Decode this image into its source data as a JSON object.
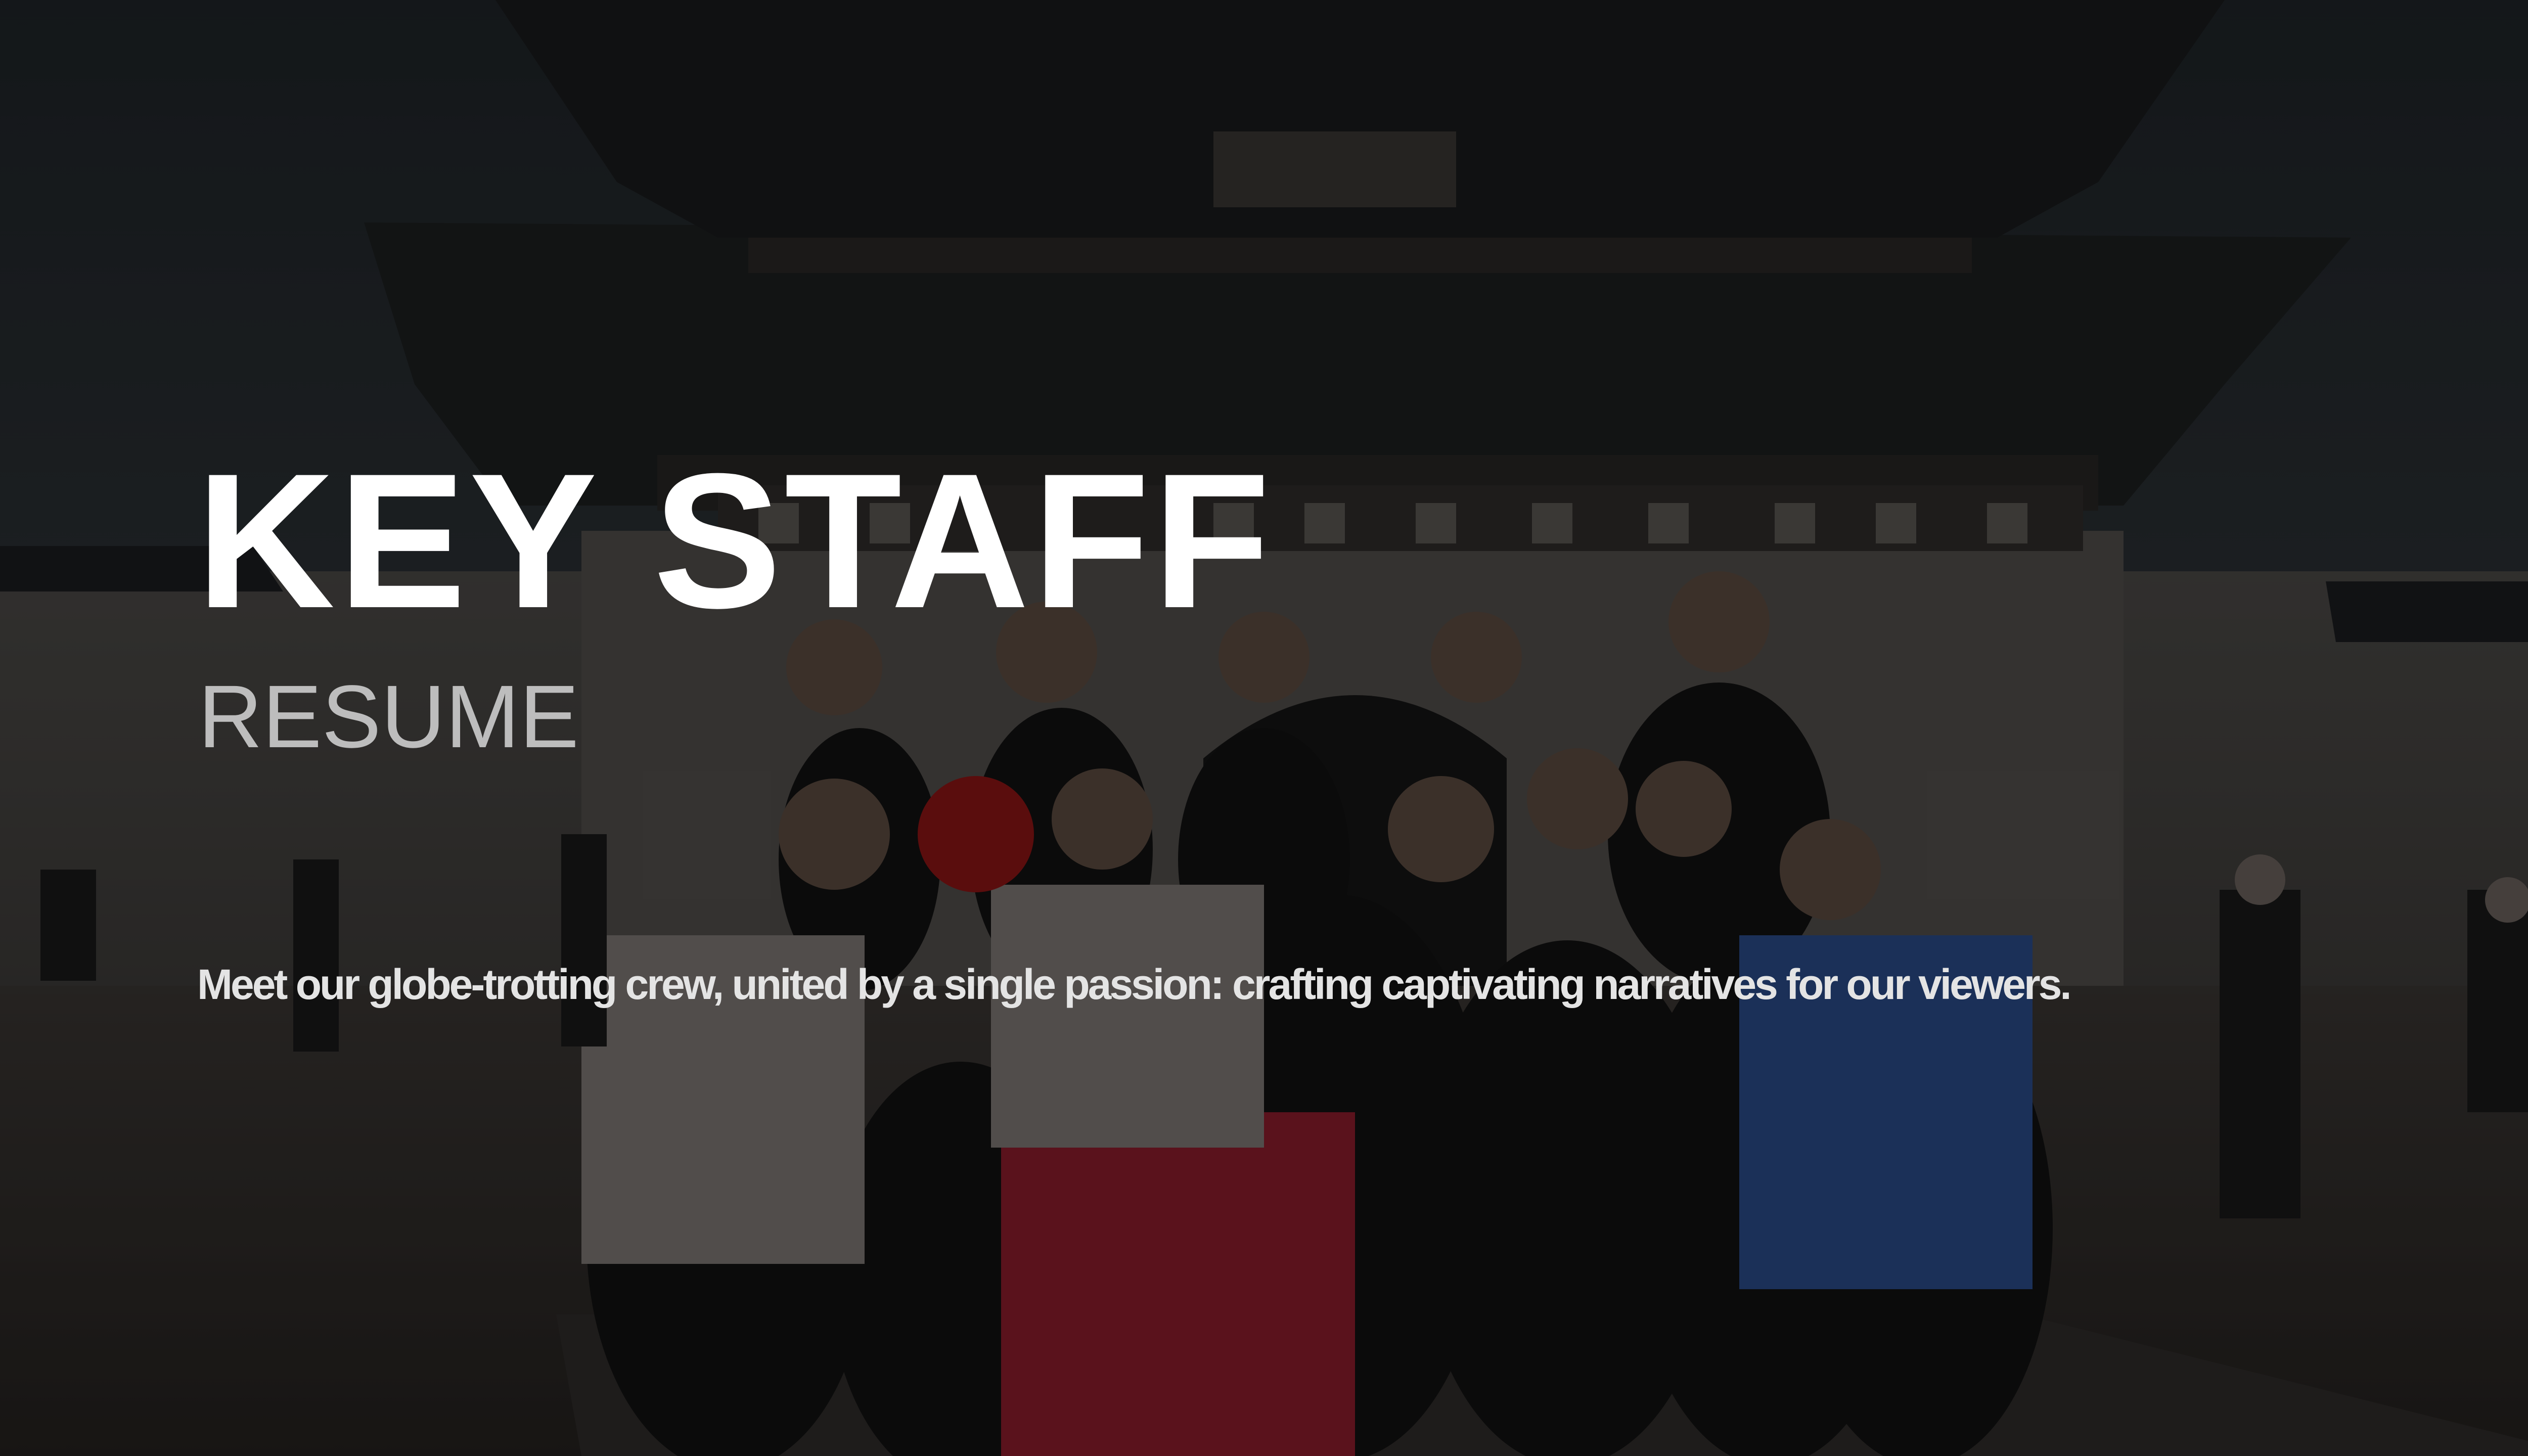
{
  "slide": {
    "title": "KEY STAFF",
    "subtitle": "RESUME",
    "tagline": "Meet our globe-trotting crew, united by a single passion: crafting captivating narratives for our viewers."
  },
  "background": {
    "description_icon": "group-photo-palace-gate",
    "tone": "#2a2a2a"
  },
  "colors": {
    "title": "#ffffff",
    "subtitle": "#bdbdbd",
    "tagline": "#e4e4e4"
  }
}
